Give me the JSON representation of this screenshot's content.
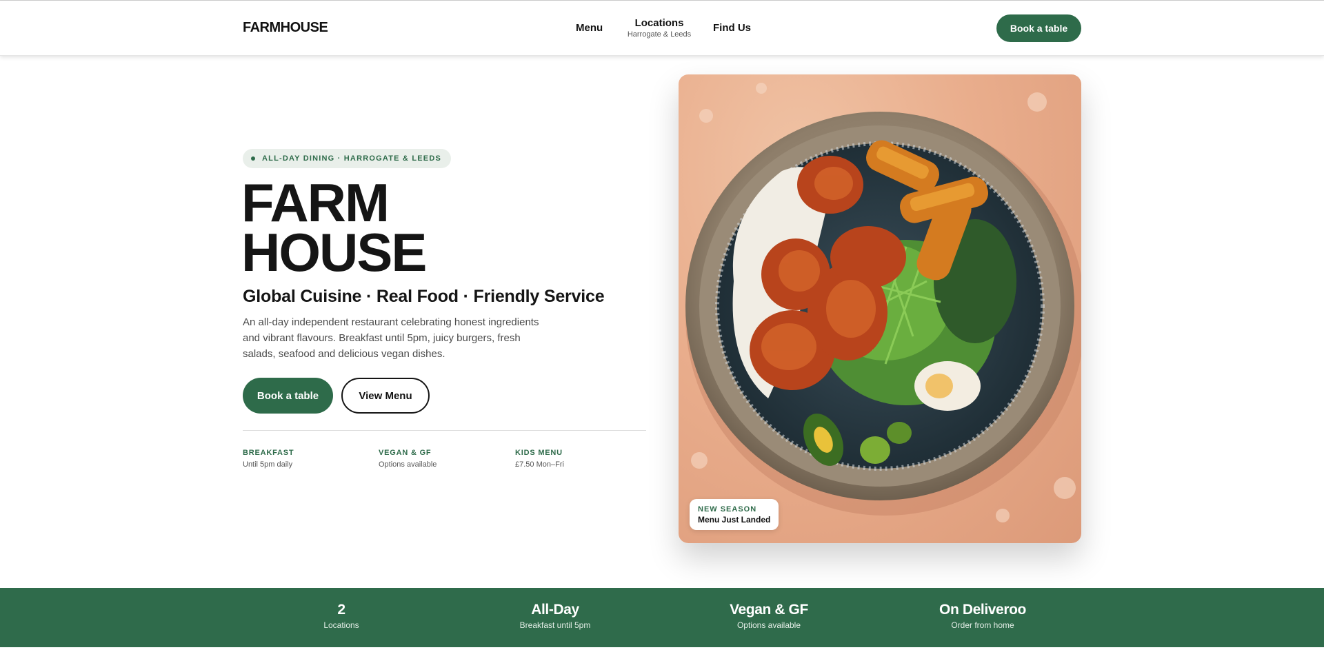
{
  "header": {
    "logo": "FARMHOUSE",
    "nav": {
      "menu": "Menu",
      "locations": "Locations",
      "locations_sub": "Harrogate & Leeds",
      "find_us": "Find Us"
    },
    "cta": "Book a table"
  },
  "hero": {
    "eyebrow": "ALL-DAY DINING · HARROGATE & LEEDS",
    "title_line1": "FARM",
    "title_line2": "HOUSE",
    "tagline": "Global Cuisine · Real Food · Friendly Service",
    "description": "An all-day independent restaurant celebrating honest ingredients and vibrant flavours. Breakfast until 5pm, juicy burgers, fresh salads, seafood and delicious vegan dishes.",
    "primary_button": "Book a table",
    "secondary_button": "View Menu",
    "features": [
      {
        "title": "BREAKFAST",
        "sub": "Until 5pm daily"
      },
      {
        "title": "VEGAN & GF",
        "sub": "Options available"
      },
      {
        "title": "KIDS MENU",
        "sub": "£7.50 Mon–Fri"
      }
    ],
    "photo_badge": {
      "label": "NEW SEASON",
      "title": "Menu Just Landed"
    }
  },
  "stats": [
    {
      "value": "2",
      "label": "Locations"
    },
    {
      "value": "All-Day",
      "label": "Breakfast until 5pm"
    },
    {
      "value": "Vegan & GF",
      "label": "Options available"
    },
    {
      "value": "On Deliveroo",
      "label": "Order from home"
    }
  ],
  "colors": {
    "brand_green": "#2e6b4a",
    "text_dark": "#151515",
    "background": "#ffffff"
  }
}
